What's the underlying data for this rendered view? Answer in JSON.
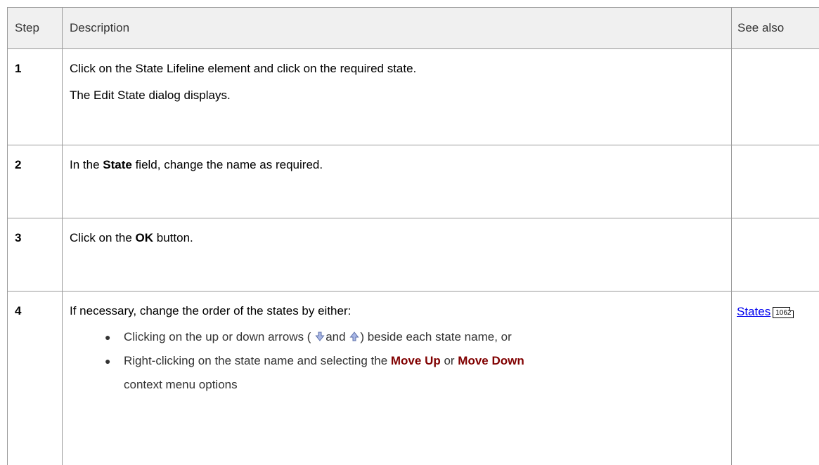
{
  "table": {
    "headers": {
      "step": "Step",
      "description": "Description",
      "see_also": "See also"
    },
    "rows": [
      {
        "step": "1",
        "lines": [
          "Click on the State Lifeline element and click on the required state.",
          "The Edit State dialog displays."
        ]
      },
      {
        "step": "2",
        "pre": "In the ",
        "bold": "State",
        "post": " field, change the name as required."
      },
      {
        "step": "3",
        "pre": "Click on the ",
        "bold": "OK",
        "post": " button."
      },
      {
        "step": "4",
        "intro": "If necessary, change the order of the states by either:",
        "bullet1": {
          "pre": "Clicking on the up or down arrows (",
          "mid": "and",
          "post": ") beside each state name, or"
        },
        "bullet2": {
          "pre": "Right-clicking on the state name and selecting the ",
          "menu1": "Move Up",
          "or": " or ",
          "menu2": "Move Down",
          "post": " context menu options"
        },
        "see_also": {
          "link": "States",
          "page": "1062"
        }
      }
    ]
  },
  "icons": {
    "bullet": "bullet-dot",
    "down_arrow": "down-arrow-icon",
    "up_arrow": "up-arrow-icon"
  },
  "colors": {
    "border": "#9a9a9a",
    "header_bg": "#f0f0f0",
    "menu_text": "#800000",
    "link": "#0000ee",
    "arrow_fill": "#a9b7e6"
  }
}
